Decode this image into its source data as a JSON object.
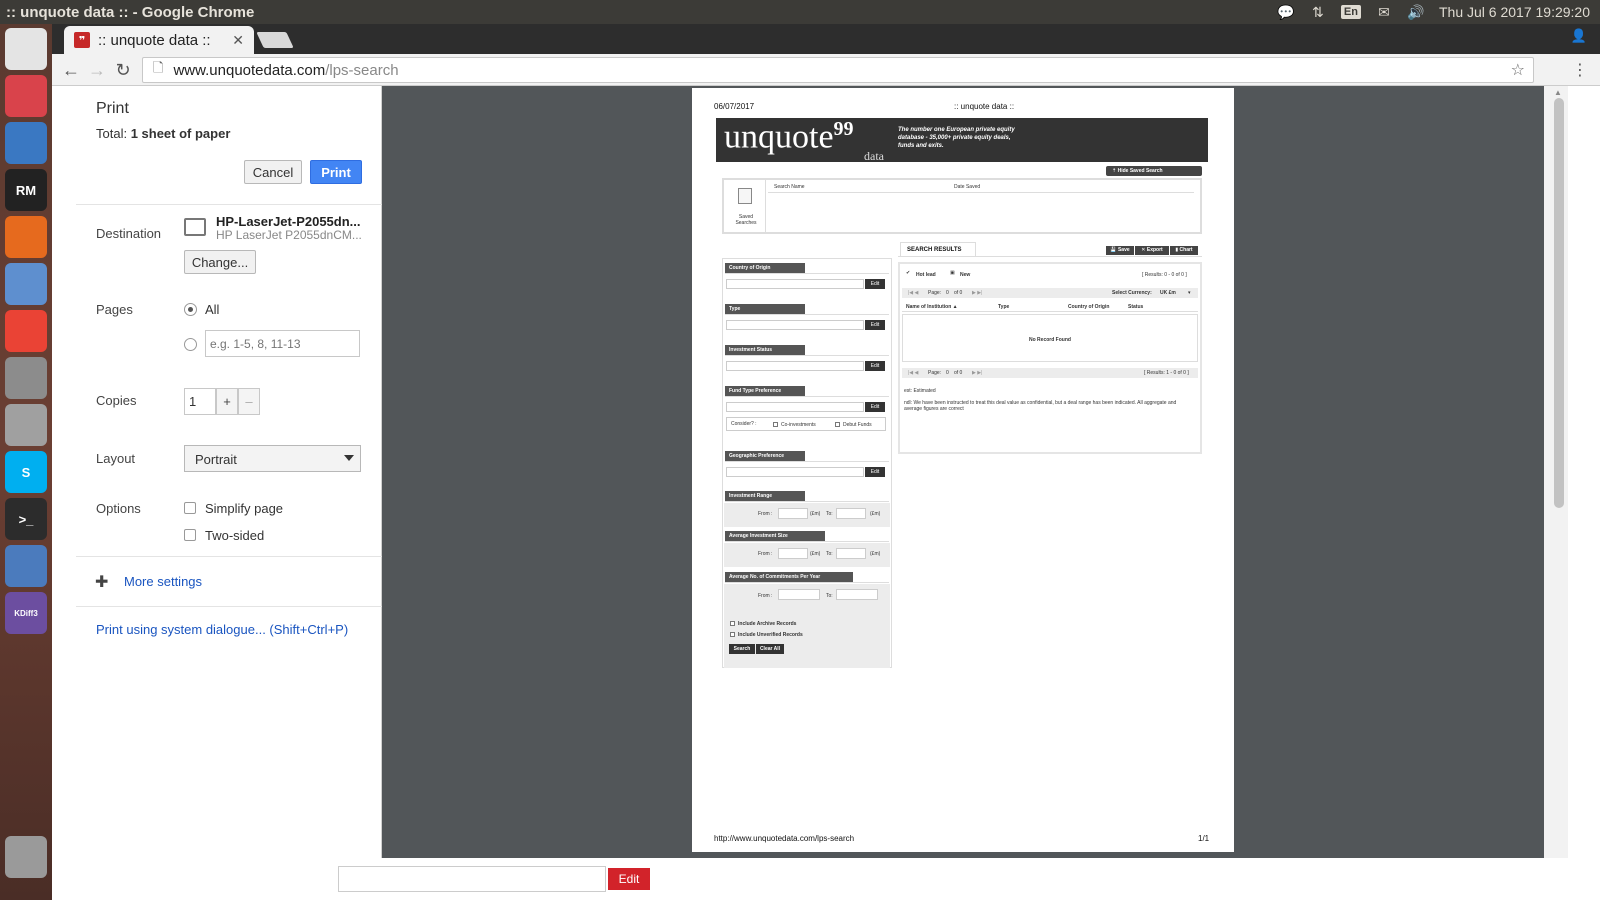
{
  "os": {
    "window_title": ":: unquote data :: - Google Chrome",
    "lang": "En",
    "clock": "Thu Jul  6 2017 19:29:20"
  },
  "launcher": [
    {
      "label": "",
      "color": "#e4e4e4",
      "name": "ubuntu-dash-icon"
    },
    {
      "label": "",
      "color": "#d9434b",
      "name": "chat-app-icon"
    },
    {
      "label": "",
      "color": "#3a78c2",
      "name": "thunderbird-icon"
    },
    {
      "label": "RM",
      "color": "#222222",
      "name": "rubymine-icon"
    },
    {
      "label": "",
      "color": "#e66a1e",
      "name": "firefox-icon"
    },
    {
      "label": "",
      "color": "#5e8fcf",
      "name": "chromium-icon"
    },
    {
      "label": "",
      "color": "#ea4335",
      "name": "chrome-icon"
    },
    {
      "label": "",
      "color": "#8c8c8c",
      "name": "files-icon"
    },
    {
      "label": "",
      "color": "#a0a0a0",
      "name": "text-editor-icon"
    },
    {
      "label": "S",
      "color": "#00aff0",
      "name": "skype-icon"
    },
    {
      "label": ">_",
      "color": "#2c2c2c",
      "name": "terminal-icon"
    },
    {
      "label": "",
      "color": "#4b7bbd",
      "name": "virtualbox-icon"
    },
    {
      "label": "KDiff3",
      "color": "#6c4ea0",
      "name": "kdiff3-icon"
    },
    {
      "label": "",
      "color": "#9a9a9a",
      "name": "trash-icon"
    }
  ],
  "browser": {
    "tab_title": ":: unquote data ::",
    "url_host": "www.unquotedata.com",
    "url_path": "/lps-search"
  },
  "page": {
    "edit_label": "Edit"
  },
  "print": {
    "title": "Print",
    "total_prefix": "Total: ",
    "total_value": "1 sheet of paper",
    "cancel": "Cancel",
    "print": "Print",
    "destination_label": "Destination",
    "printer_name": "HP-LaserJet-P2055dn...",
    "printer_sub": "HP LaserJet P2055dnCM...",
    "change": "Change...",
    "pages_label": "Pages",
    "pages_all": "All",
    "pages_placeholder": "e.g. 1-5, 8, 11-13",
    "copies_label": "Copies",
    "copies_value": "1",
    "plus": "+",
    "minus": "–",
    "layout_label": "Layout",
    "layout_value": "Portrait",
    "options_label": "Options",
    "simplify": "Simplify page",
    "two_sided": "Two-sided",
    "more_settings": "More settings",
    "system_dialogue": "Print using system dialogue... (Shift+Ctrl+P)"
  },
  "preview": {
    "date": "06/07/2017",
    "doc_title": ":: unquote data ::",
    "logo": "unquote",
    "logo_quote": "99",
    "logo_sub": "data",
    "tagline": "The number one European private equity database - 35,000+ private equity deals, funds and exits.",
    "hide_saved": "Hide Saved Search",
    "saved_searches": "Saved Searches",
    "col_search_name": "Search Name",
    "col_date_saved": "Date Saved",
    "filters": {
      "country": "Country of Origin",
      "type": "Type",
      "inv_status": "Investment Status",
      "fund_type": "Fund Type Preference",
      "consider": "Consider? :",
      "co_invest": "Co-investments",
      "debut": "Debut Funds",
      "geo": "Geographic Preference",
      "inv_range": "Investment Range",
      "avg_size": "Average Investment Size",
      "avg_commit": "Average No. of Commitments Per Year",
      "from": "From :",
      "to": "To:",
      "unit": "(£m)",
      "edit": "Edit",
      "archive": "Include Archive Records",
      "unverified": "Include Unverified Records",
      "search": "Search",
      "clear": "Clear All"
    },
    "results": {
      "tab": "SEARCH RESULTS",
      "save": "Save",
      "export": "Export",
      "chart": "Chart",
      "hot_lead": "Hot lead",
      "new": "New",
      "results_top": "[ Results: 0 - 0 of 0 ]",
      "page": "Page:",
      "page_num": "0",
      "of": "of 0",
      "currency_label": "Select Currency:",
      "currency": "UK £m",
      "col_name": "Name of Institution",
      "col_type": "Type",
      "col_country": "Country of Origin",
      "col_status": "Status",
      "no_record": "No Record Found",
      "results_bottom": "[ Results: 1 - 0 of 0 ]",
      "est": "est: Estimated",
      "ndl": "ndl: We have been instructed to treat this deal value as confidential, but a deal range has been indicated. All aggregate and average figures are correct"
    },
    "footer_url": "http://www.unquotedata.com/lps-search",
    "footer_page": "1/1"
  }
}
